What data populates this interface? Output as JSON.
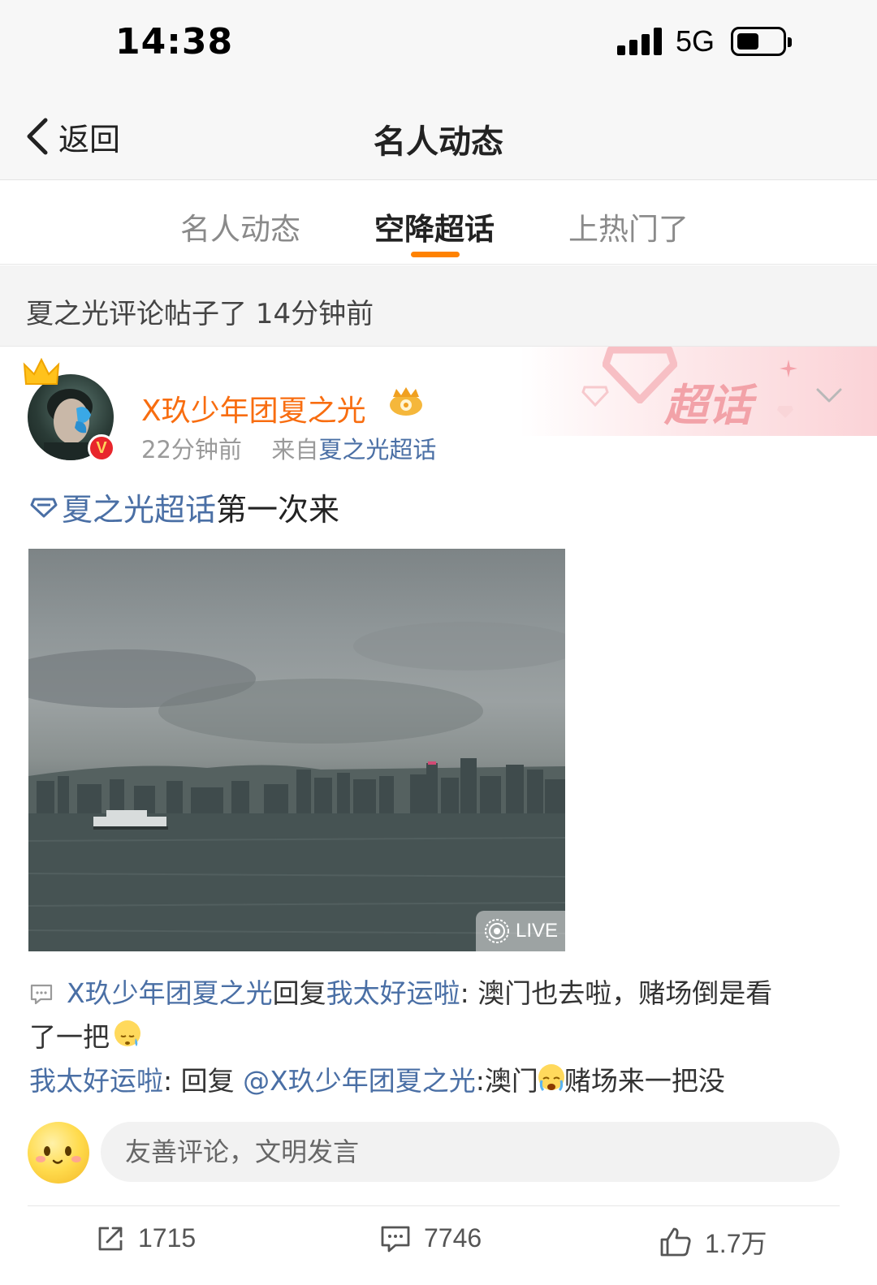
{
  "status_bar": {
    "time": "14:38",
    "network": "5G"
  },
  "nav": {
    "back_label": "返回",
    "title": "名人动态"
  },
  "tabs": [
    {
      "label": "名人动态",
      "active": false
    },
    {
      "label": "空降超话",
      "active": true
    },
    {
      "label": "上热门了",
      "active": false
    }
  ],
  "notice": {
    "text": "夏之光评论帖子了 14分钟前"
  },
  "post": {
    "badge": "超话",
    "author": "X玖少年团夏之光",
    "verified_mark": "V",
    "time": "22分钟前",
    "source_prefix": "来自",
    "source": "夏之光超话",
    "topic": "夏之光超话",
    "text": "第一次来",
    "photo_badge": "LIVE"
  },
  "comments": [
    {
      "user": "X玖少年团夏之光",
      "reply_word": "回复",
      "target": "我太好运啦",
      "text_line1": ": 澳门也去啦，赌场倒是看",
      "text_line2": "了一把"
    },
    {
      "user": "我太好运啦",
      "reply_prefix": ": 回复 ",
      "mention": "@X玖少年团夏之光",
      "text_a": ":澳门",
      "text_b": "赌场来一把没"
    }
  ],
  "comment_input": {
    "placeholder": "友善评论，文明发言"
  },
  "actions": {
    "reposts": "1715",
    "comments": "7746",
    "likes": "1.7万"
  },
  "colors": {
    "accent": "#ff8200",
    "username": "#f86d10",
    "link": "#4a6fa5"
  }
}
